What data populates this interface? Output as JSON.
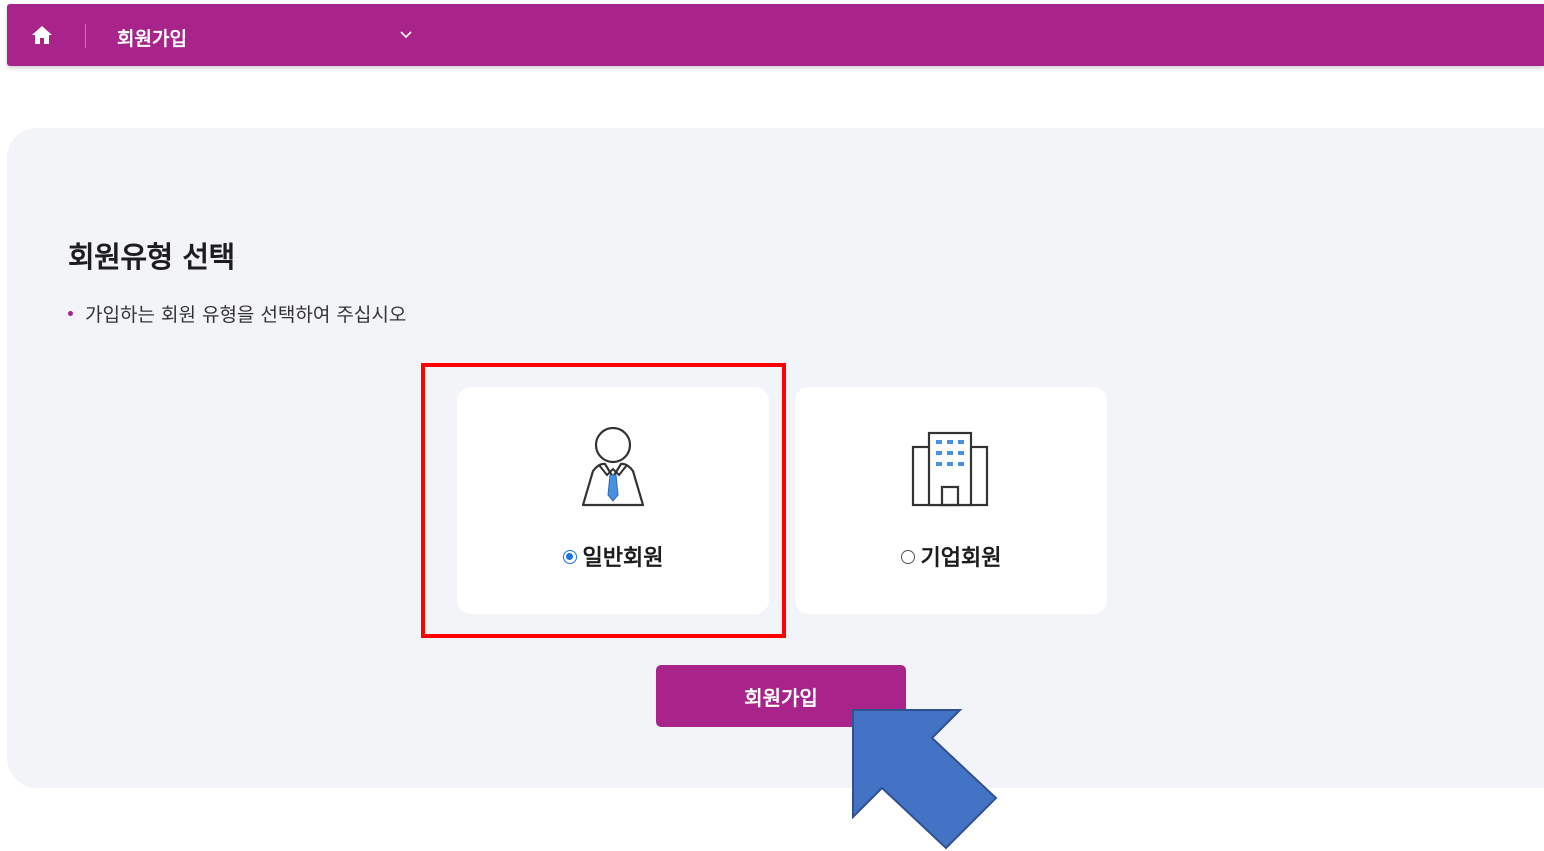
{
  "header": {
    "home_icon": "home-icon",
    "breadcrumb_label": "회원가입",
    "dropdown_icon": "chevron-down-icon",
    "brand_color": "#a8238a"
  },
  "main": {
    "title": "회원유형 선택",
    "instruction": "가입하는 회원 유형을 선택하여 주십시오",
    "member_types": [
      {
        "label": "일반회원",
        "icon": "person-icon",
        "selected": true
      },
      {
        "label": "기업회원",
        "icon": "building-icon",
        "selected": false
      }
    ],
    "signup_button_label": "회원가입"
  },
  "annotations": {
    "highlight_color": "#ff0000",
    "arrow_color": "#4472c4"
  }
}
